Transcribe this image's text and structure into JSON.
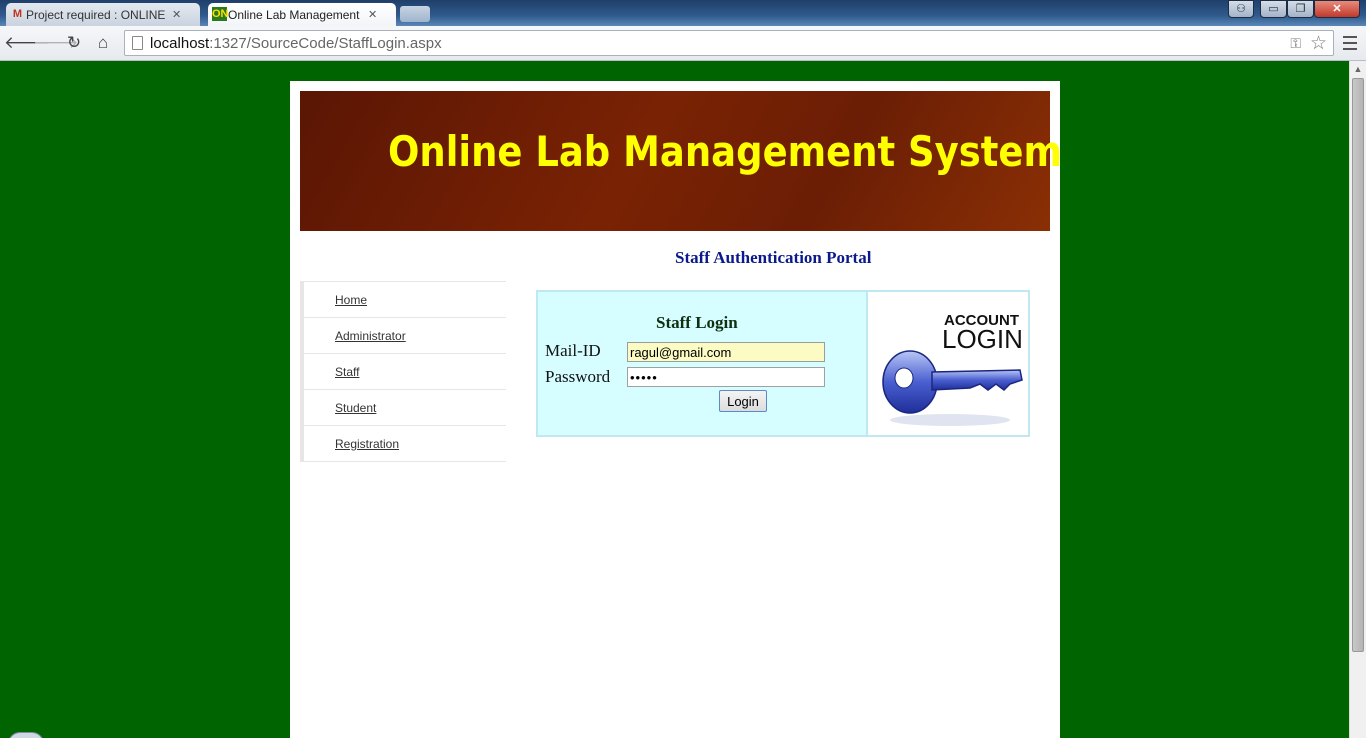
{
  "browser": {
    "tabs": [
      {
        "title": "Project required : ONLINE",
        "favicon": "M",
        "favicon_color": "#c23321",
        "active": false
      },
      {
        "title": "Online Lab Management S",
        "favicon": "ON",
        "favicon_color": "#2a7a1e",
        "active": true
      }
    ],
    "url_host": "localhost",
    "url_path": ":1327/SourceCode/StaffLogin.aspx",
    "window_controls": {
      "minimize": "▭",
      "restore": "❐",
      "close": "✕"
    }
  },
  "page": {
    "banner_title": "Online Lab Management System",
    "portal_title": "Staff Authentication Portal",
    "menu": [
      {
        "label": "Home"
      },
      {
        "label": "Administrator"
      },
      {
        "label": "Staff"
      },
      {
        "label": "Student"
      },
      {
        "label": "Registration"
      }
    ],
    "login": {
      "title": "Staff Login",
      "mail_label": "Mail-ID",
      "mail_value": "ragul@gmail.com",
      "password_label": "Password",
      "password_value": "•••••",
      "button_label": "Login"
    },
    "account_image": {
      "line1": "ACCOUNT",
      "line2": "LOGIN"
    }
  },
  "colors": {
    "page_background": "#006400",
    "banner_text": "#ffff00",
    "portal_title": "#0a1a8c",
    "login_panel": "#d6fdff"
  }
}
